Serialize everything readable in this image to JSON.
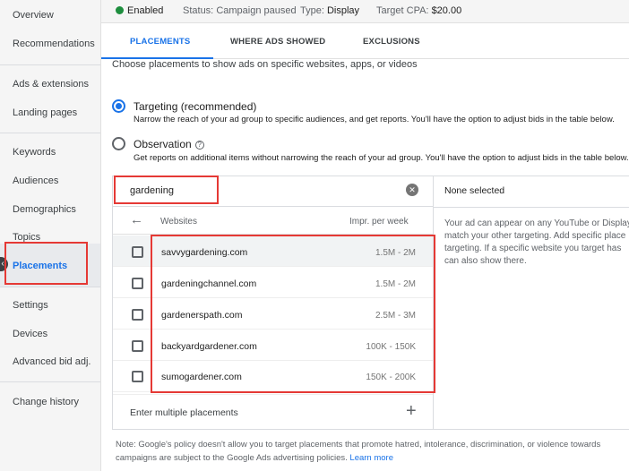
{
  "sidebar": {
    "items": [
      {
        "label": "Overview"
      },
      {
        "label": "Recommendations"
      },
      {
        "label": "Ads & extensions"
      },
      {
        "label": "Landing pages"
      },
      {
        "label": "Keywords"
      },
      {
        "label": "Audiences"
      },
      {
        "label": "Demographics"
      },
      {
        "label": "Topics"
      },
      {
        "label": "Placements"
      },
      {
        "label": "Settings"
      },
      {
        "label": "Devices"
      },
      {
        "label": "Advanced bid adj."
      },
      {
        "label": "Change history"
      }
    ],
    "active": "Placements",
    "collapse_icon": "chevron-left-icon"
  },
  "status_bar": {
    "enabled": "Enabled",
    "status_key": "Status:",
    "status_val": "Campaign paused",
    "type_key": "Type:",
    "type_val": "Display",
    "cpa_key": "Target CPA:",
    "cpa_val": "$20.00"
  },
  "tabs": [
    {
      "label": "PLACEMENTS",
      "active": true
    },
    {
      "label": "WHERE ADS SHOWED",
      "active": false
    },
    {
      "label": "EXCLUSIONS",
      "active": false
    }
  ],
  "intro": "Choose placements to show ads on specific websites, apps, or videos",
  "options": {
    "targeting": {
      "title": "Targeting (recommended)",
      "desc": "Narrow the reach of your ad group to specific audiences, and get reports. You'll have the option to adjust bids in the table below.",
      "selected": true
    },
    "observation": {
      "title": "Observation",
      "desc": "Get reports on additional items without narrowing the reach of your ad group. You'll have the option to adjust bids in the table below.",
      "selected": false
    }
  },
  "search": {
    "value": "gardening"
  },
  "list": {
    "col_websites": "Websites",
    "col_impr": "Impr. per week",
    "rows": [
      {
        "site": "savvygardening.com",
        "impr": "1.5M - 2M"
      },
      {
        "site": "gardeningchannel.com",
        "impr": "1.5M - 2M"
      },
      {
        "site": "gardenerspath.com",
        "impr": "2.5M - 3M"
      },
      {
        "site": "backyardgardener.com",
        "impr": "100K - 150K"
      },
      {
        "site": "sumogardener.com",
        "impr": "150K - 200K"
      }
    ],
    "enter_multiple": "Enter multiple placements"
  },
  "right_panel": {
    "header": "None selected",
    "lines": [
      "Your ad can appear on any YouTube or Display",
      "match your other targeting. Add specific place",
      "targeting. If a specific website you target has",
      "can also show there."
    ]
  },
  "note": {
    "line1": "Note: Google's policy doesn't allow you to target placements that promote hatred, intolerance, discrimination, or violence towards",
    "line2": "campaigns are subject to the Google Ads advertising policies.",
    "learn_more": "Learn more"
  },
  "colors": {
    "accent": "#1a73e8",
    "highlight": "#e53935",
    "enabled": "#1e8e3e"
  }
}
